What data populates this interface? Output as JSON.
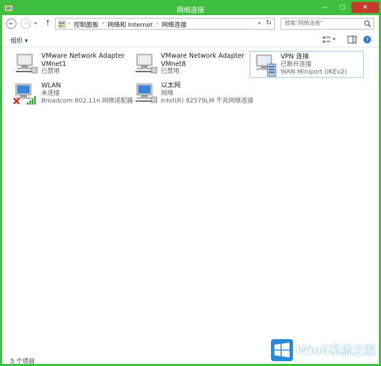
{
  "window": {
    "title": "网络连接"
  },
  "address": {
    "breadcrumbs": [
      "控制面板",
      "网络和 Internet",
      "网络连接"
    ],
    "separator": "›"
  },
  "search": {
    "placeholder": "搜索\"网络连接\""
  },
  "toolbar": {
    "organize_label": "组织 ▾"
  },
  "connections": [
    {
      "name": "VMware Network Adapter",
      "line2": "VMnet1",
      "line3": "已禁用",
      "icon": "network-adapter-icon",
      "selected": false
    },
    {
      "name": "VMware Network Adapter",
      "line2": "VMnet8",
      "line3": "已禁用",
      "icon": "network-adapter-icon",
      "selected": false
    },
    {
      "name": "VPN 连接",
      "line2": "已断开连接",
      "line3": "WAN Miniport (IKEv2)",
      "icon": "vpn-icon",
      "selected": true
    },
    {
      "name": "WLAN",
      "line2": "未连接",
      "line3": "Broadcom 802.11n 网络适配器",
      "icon": "wlan-icon",
      "selected": false
    },
    {
      "name": "以太网",
      "line2": "网络",
      "line3": "Intel(R) 82579LM 千兆网络连接",
      "icon": "ethernet-icon",
      "selected": false
    }
  ],
  "status": {
    "item_count": "5 个项目"
  },
  "watermark": {
    "text": "Win8系统之家"
  },
  "colors": {
    "titlebar": "#3fbf3f",
    "close": "#c43c2c",
    "link": "#1e395b"
  }
}
